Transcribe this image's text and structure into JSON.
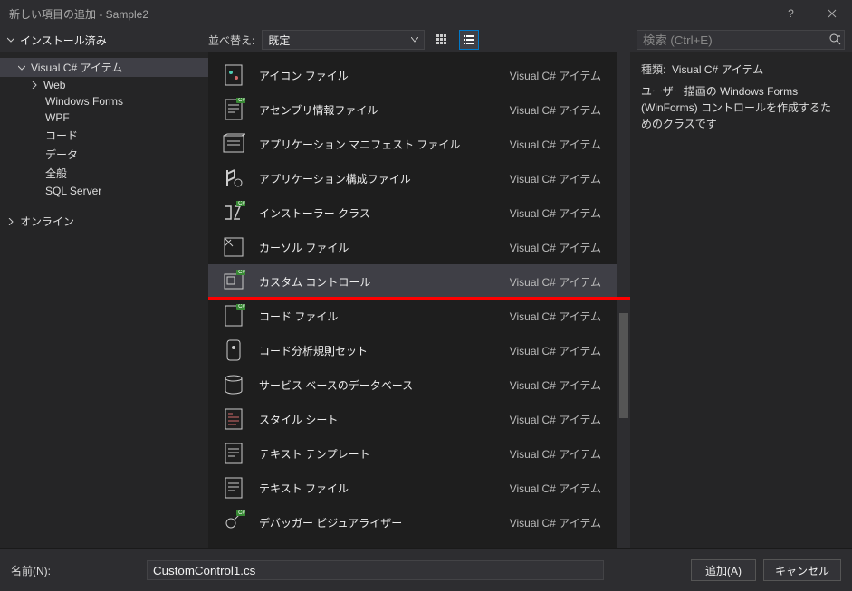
{
  "window": {
    "title": "新しい項目の追加 - Sample2"
  },
  "toolbar": {
    "installed_label": "インストール済み",
    "sort_label": "並べ替え:",
    "sort_value": "既定",
    "search_placeholder": "検索 (Ctrl+E)"
  },
  "tree": {
    "root": "Visual C# アイテム",
    "items": [
      "Web",
      "Windows Forms",
      "WPF",
      "コード",
      "データ",
      "全般",
      "SQL Server"
    ],
    "online": "オンライン"
  },
  "items": [
    {
      "name": "アイコン ファイル",
      "cat": "Visual C# アイテム",
      "selected": false
    },
    {
      "name": "アセンブリ情報ファイル",
      "cat": "Visual C# アイテム",
      "selected": false
    },
    {
      "name": "アプリケーション マニフェスト ファイル",
      "cat": "Visual C# アイテム",
      "selected": false
    },
    {
      "name": "アプリケーション構成ファイル",
      "cat": "Visual C# アイテム",
      "selected": false
    },
    {
      "name": "インストーラー クラス",
      "cat": "Visual C# アイテム",
      "selected": false
    },
    {
      "name": "カーソル ファイル",
      "cat": "Visual C# アイテム",
      "selected": false
    },
    {
      "name": "カスタム コントロール",
      "cat": "Visual C# アイテム",
      "selected": true
    },
    {
      "name": "コード ファイル",
      "cat": "Visual C# アイテム",
      "selected": false
    },
    {
      "name": "コード分析規則セット",
      "cat": "Visual C# アイテム",
      "selected": false
    },
    {
      "name": "サービス ベースのデータベース",
      "cat": "Visual C# アイテム",
      "selected": false
    },
    {
      "name": "スタイル シート",
      "cat": "Visual C# アイテム",
      "selected": false
    },
    {
      "name": "テキスト テンプレート",
      "cat": "Visual C# アイテム",
      "selected": false
    },
    {
      "name": "テキスト ファイル",
      "cat": "Visual C# アイテム",
      "selected": false
    },
    {
      "name": "デバッガー ビジュアライザー",
      "cat": "Visual C# アイテム",
      "selected": false
    }
  ],
  "detail": {
    "type_label": "種類:",
    "type_value": "Visual C# アイテム",
    "description": "ユーザー描画の Windows Forms (WinForms) コントロールを作成するためのクラスです"
  },
  "bottom": {
    "name_label": "名前(N):",
    "name_value": "CustomControl1.cs"
  },
  "buttons": {
    "add": "追加(A)",
    "cancel": "キャンセル"
  },
  "annotation": {
    "redline_after_index": 6
  }
}
